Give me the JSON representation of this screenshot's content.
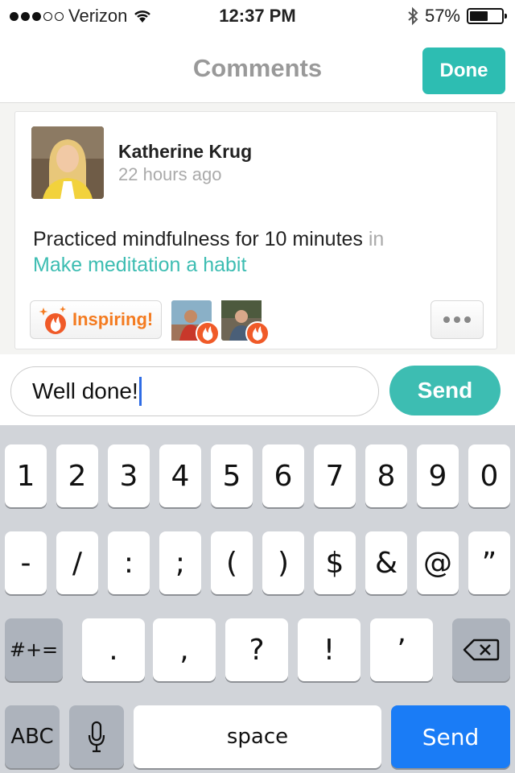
{
  "status_bar": {
    "carrier": "Verizon",
    "time": "12:37 PM",
    "battery": "57%",
    "battery_level": 0.57,
    "signal_bars_filled": 3,
    "signal_bars_total": 5
  },
  "nav": {
    "title": "Comments",
    "done_label": "Done"
  },
  "post": {
    "author": "Katherine Krug",
    "time_ago": "22 hours ago",
    "text": "Practiced mindfulness for 10 minutes",
    "in_word": " in",
    "habit": "Make meditation a habit",
    "inspire_label": "Inspiring!",
    "inspirer_count": 2
  },
  "comment": {
    "value": "Well done!",
    "send_label": "Send"
  },
  "keyboard": {
    "row1": [
      "1",
      "2",
      "3",
      "4",
      "5",
      "6",
      "7",
      "8",
      "9",
      "0"
    ],
    "row2": [
      "-",
      "/",
      ":",
      ";",
      "(",
      ")",
      "$",
      "&",
      "@",
      "”"
    ],
    "row3_mode": "#+=",
    "row3": [
      ".",
      ",",
      "?",
      "!",
      "’"
    ],
    "abc": "ABC",
    "space": "space",
    "send": "Send"
  },
  "colors": {
    "accent": "#3dbdb2",
    "inspire": "#f47b20",
    "flame": "#f05a28",
    "keyboard_send": "#1a7cf6"
  }
}
